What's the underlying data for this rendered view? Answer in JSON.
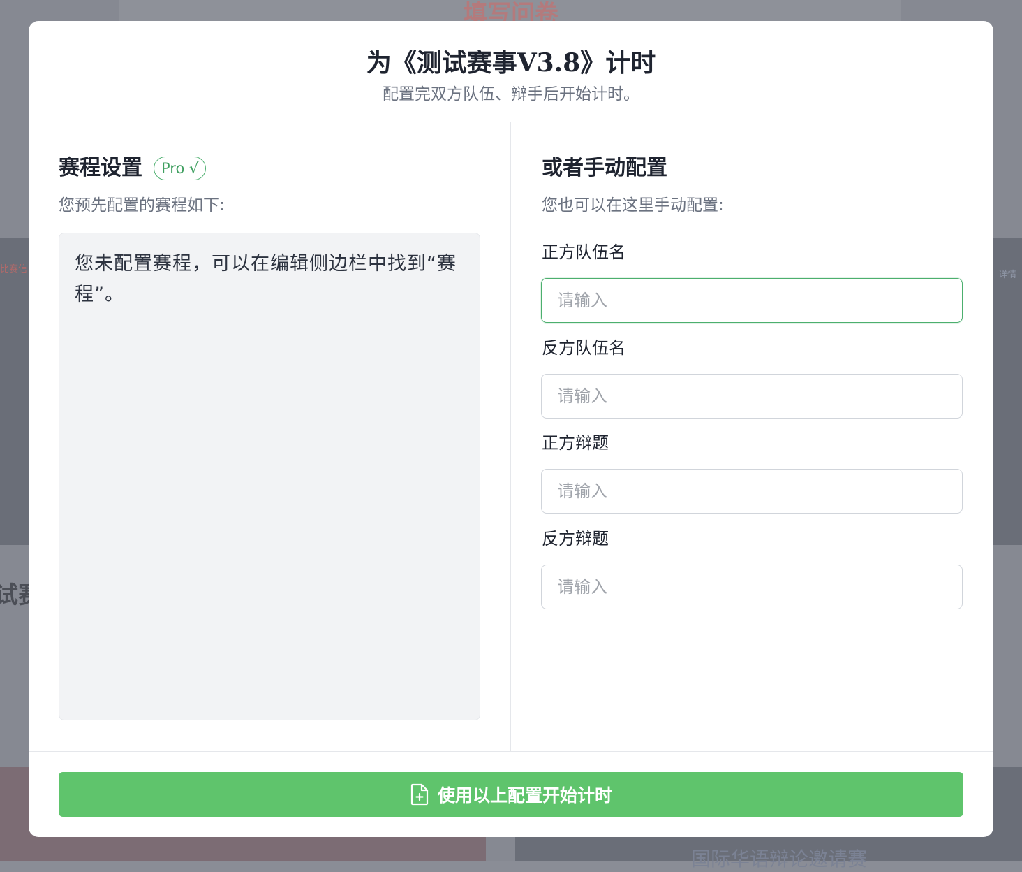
{
  "background": {
    "top_title": "填写问卷",
    "left_text": "试赛",
    "left_tag": "比赛信",
    "right_tag": "详情",
    "bottom_text": "国际华语辩论邀请赛"
  },
  "modal": {
    "title": "为《测试赛事V3.8》计时",
    "subtitle": "配置完双方队伍、辩手后开始计时。"
  },
  "schedule": {
    "title": "赛程设置",
    "badge": "Pro √",
    "desc": "您预先配置的赛程如下:",
    "content": "您未配置赛程，可以在编辑侧边栏中找到“赛程”。"
  },
  "manual": {
    "title": "或者手动配置",
    "desc": "您也可以在这里手动配置:",
    "fields": [
      {
        "label": "正方队伍名",
        "value": "",
        "placeholder": "请输入"
      },
      {
        "label": "反方队伍名",
        "value": "",
        "placeholder": "请输入"
      },
      {
        "label": "正方辩题",
        "value": "",
        "placeholder": "请输入"
      },
      {
        "label": "反方辩题",
        "value": "",
        "placeholder": "请输入"
      }
    ]
  },
  "footer": {
    "start_label": "使用以上配置开始计时",
    "start_icon": "file-plus-icon"
  },
  "colors": {
    "accent": "#5fc46c",
    "badge": "#4caf6e"
  }
}
